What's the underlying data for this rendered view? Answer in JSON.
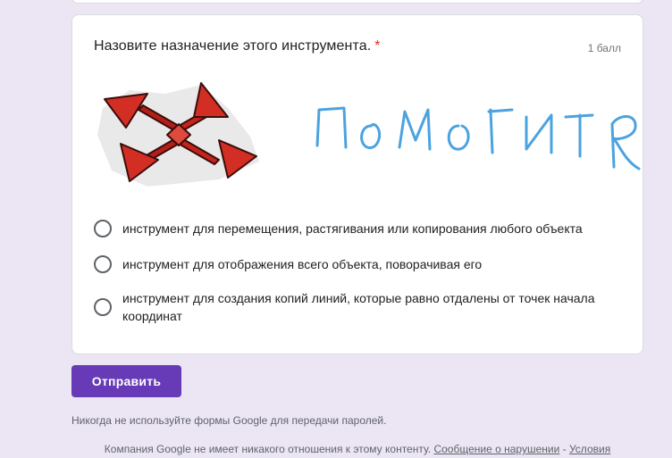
{
  "question": {
    "title": "Назовите назначение этого инструмента.",
    "required_mark": "*",
    "points": "1 балл",
    "handwritten_text": "помогите",
    "options": [
      "инструмент для перемещения, растягивания или копирования любого объекта",
      "инструмент для отображения всего объекта, поворачивая его",
      "инструмент для создания копий линий, которые равно отдалены от точек начала координат"
    ]
  },
  "actions": {
    "submit_label": "Отправить"
  },
  "notes": {
    "password_warning": "Никогда не используйте формы Google для передачи паролей."
  },
  "footer": {
    "disclaimer": "Компания Google не имеет никакого отношения к этому контенту.",
    "report_link": "Сообщение о нарушении",
    "separator": "-",
    "terms_link": "Условия"
  },
  "colors": {
    "accent": "#673ab7",
    "background": "#ece6f4",
    "required": "#d93025",
    "handwriting": "#4aa3e0",
    "arrow_red": "#cc2a22"
  }
}
